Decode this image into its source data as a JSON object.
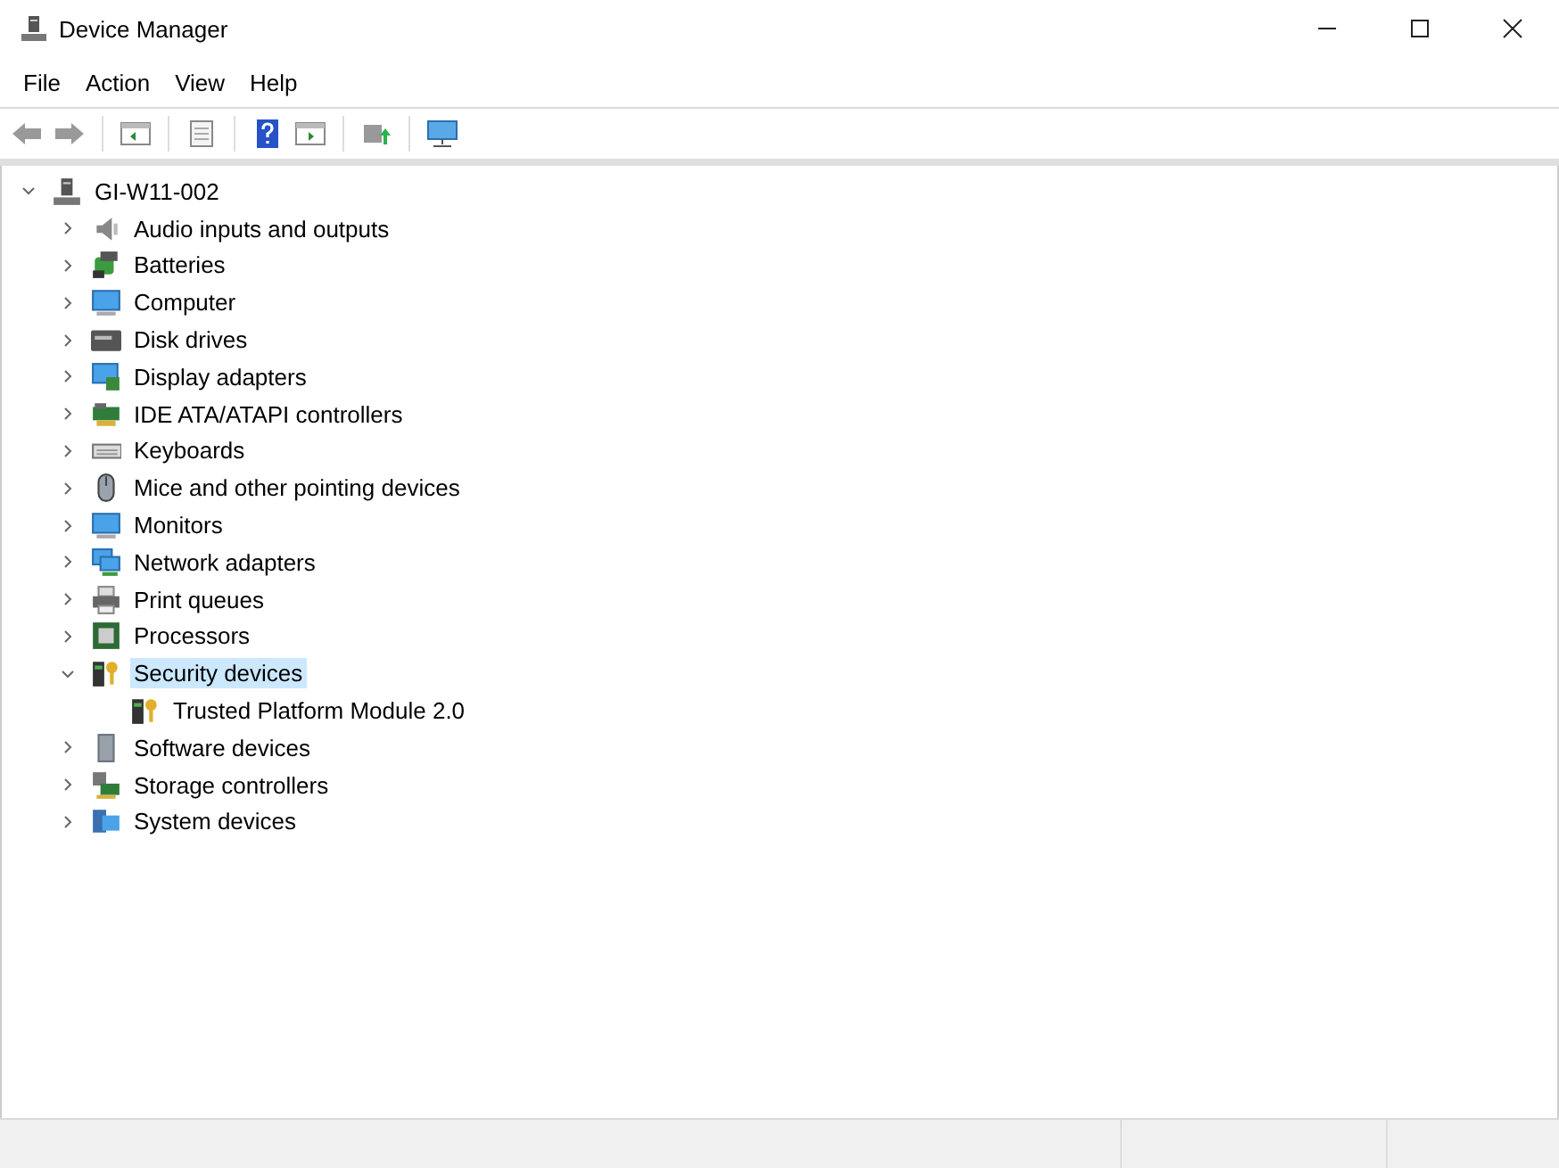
{
  "window": {
    "title": "Device Manager"
  },
  "menu": [
    "File",
    "Action",
    "View",
    "Help"
  ],
  "tree": {
    "label": "GI-W11-002",
    "expanded": true,
    "selected": false,
    "children": [
      {
        "label": "Audio inputs and outputs",
        "expanded": false,
        "selected": false
      },
      {
        "label": "Batteries",
        "expanded": false,
        "selected": false
      },
      {
        "label": "Computer",
        "expanded": false,
        "selected": false
      },
      {
        "label": "Disk drives",
        "expanded": false,
        "selected": false
      },
      {
        "label": "Display adapters",
        "expanded": false,
        "selected": false
      },
      {
        "label": "IDE ATA/ATAPI controllers",
        "expanded": false,
        "selected": false
      },
      {
        "label": "Keyboards",
        "expanded": false,
        "selected": false
      },
      {
        "label": "Mice and other pointing devices",
        "expanded": false,
        "selected": false
      },
      {
        "label": "Monitors",
        "expanded": false,
        "selected": false
      },
      {
        "label": "Network adapters",
        "expanded": false,
        "selected": false
      },
      {
        "label": "Print queues",
        "expanded": false,
        "selected": false
      },
      {
        "label": "Processors",
        "expanded": false,
        "selected": false
      },
      {
        "label": "Security devices",
        "expanded": true,
        "selected": true,
        "children": [
          {
            "label": "Trusted Platform Module 2.0",
            "selected": false
          }
        ]
      },
      {
        "label": "Software devices",
        "expanded": false,
        "selected": false
      },
      {
        "label": "Storage controllers",
        "expanded": false,
        "selected": false
      },
      {
        "label": "System devices",
        "expanded": false,
        "selected": false
      }
    ]
  }
}
